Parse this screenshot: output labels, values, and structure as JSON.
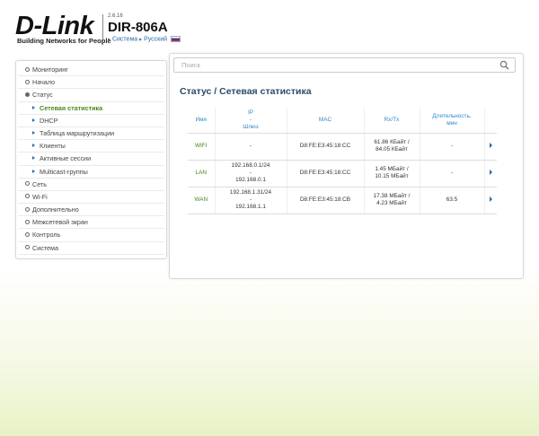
{
  "header": {
    "logo": "D-Link",
    "logo_tagline": "Building Networks for People",
    "version": "2.6.16",
    "model": "DIR-806A",
    "crumb_system": "Система",
    "crumb_language": "Русский"
  },
  "sidebar": {
    "items": [
      {
        "label": "Мониторинг"
      },
      {
        "label": "Начало"
      },
      {
        "label": "Статус"
      },
      {
        "label": "Сетевая статистика"
      },
      {
        "label": "DHCP"
      },
      {
        "label": "Таблица маршрутизации"
      },
      {
        "label": "Клиенты"
      },
      {
        "label": "Активные сессии"
      },
      {
        "label": "Multicast-группы"
      },
      {
        "label": "Сеть"
      },
      {
        "label": "Wi-Fi"
      },
      {
        "label": "Дополнительно"
      },
      {
        "label": "Межсетевой экран"
      },
      {
        "label": "Контроль"
      },
      {
        "label": "Система"
      }
    ]
  },
  "search": {
    "placeholder": "Поиск"
  },
  "page": {
    "title": "Статус /  Сетевая статистика"
  },
  "table": {
    "headers": {
      "name": "Имя",
      "ip_line1": "IP",
      "ip_line2": "-",
      "ip_line3": "Шлюз",
      "mac": "MAC",
      "rxtx": "Rx/Tx",
      "duration_line1": "Длительность,",
      "duration_line2": "мин"
    },
    "rows": [
      {
        "name": "WIFI",
        "ip": "-",
        "dash": "",
        "gw": "",
        "mac": "D8:FE:E3:45:18:CC",
        "rx": "61.86 КБайт /",
        "tx": "84.05 КБайт",
        "duration": "-"
      },
      {
        "name": "LAN",
        "ip": "192.168.0.1/24",
        "dash": "-",
        "gw": "192.168.0.1",
        "mac": "D8:FE:E3:45:18:CC",
        "rx": "1.45 МБайт /",
        "tx": "10.15 МБайт",
        "duration": "-"
      },
      {
        "name": "WAN",
        "ip": "192.168.1.31/24",
        "dash": "-",
        "gw": "192.168.1.1",
        "mac": "D8:FE:E3:45:18:CB",
        "rx": "17.38 МБайт /",
        "tx": "4.23 МБайт",
        "duration": "63.5"
      }
    ]
  },
  "colors": {
    "accent_blue": "#2a8ac8",
    "active_green": "#4a8a1c",
    "title_blue": "#2a4a6a"
  }
}
